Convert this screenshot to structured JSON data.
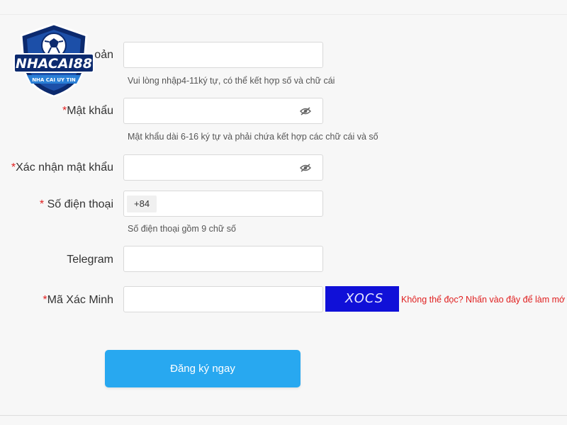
{
  "brand": {
    "name": "NHACAI88",
    "tagline": "NHA CAI UY TIN"
  },
  "form": {
    "username": {
      "label_partial": "oản",
      "value": "",
      "hint": "Vui lòng nhập4-11ký tự, có thể kết hợp số và chữ cái"
    },
    "password": {
      "required_mark": "*",
      "label": "Mật khẩu",
      "value": "",
      "hint": "Mật khẩu dài 6-16 ký tự và phải chứa kết hợp các chữ cái và số",
      "icon": "eye-off-icon"
    },
    "confirm_password": {
      "required_mark": "*",
      "label": "Xác nhận mật khẩu",
      "value": "",
      "icon": "eye-off-icon"
    },
    "phone": {
      "required_mark": "* ",
      "label": "Số điện thoại",
      "prefix": "+84",
      "value": "",
      "hint": "Số điện thoại gồm 9 chữ số"
    },
    "telegram": {
      "label": "Telegram",
      "value": ""
    },
    "verification": {
      "required_mark": "*",
      "label": "Mã Xác Minh",
      "value": "",
      "captcha_text": "XOCS",
      "refresh_text": "Không thể đọc? Nhấn vào đây để làm mớ"
    },
    "submit_label": "Đăng ký ngay"
  },
  "colors": {
    "accent": "#28a8f0",
    "required": "#e02020",
    "captcha_bg": "#1010d8",
    "page_bg": "#f7f7f7"
  }
}
